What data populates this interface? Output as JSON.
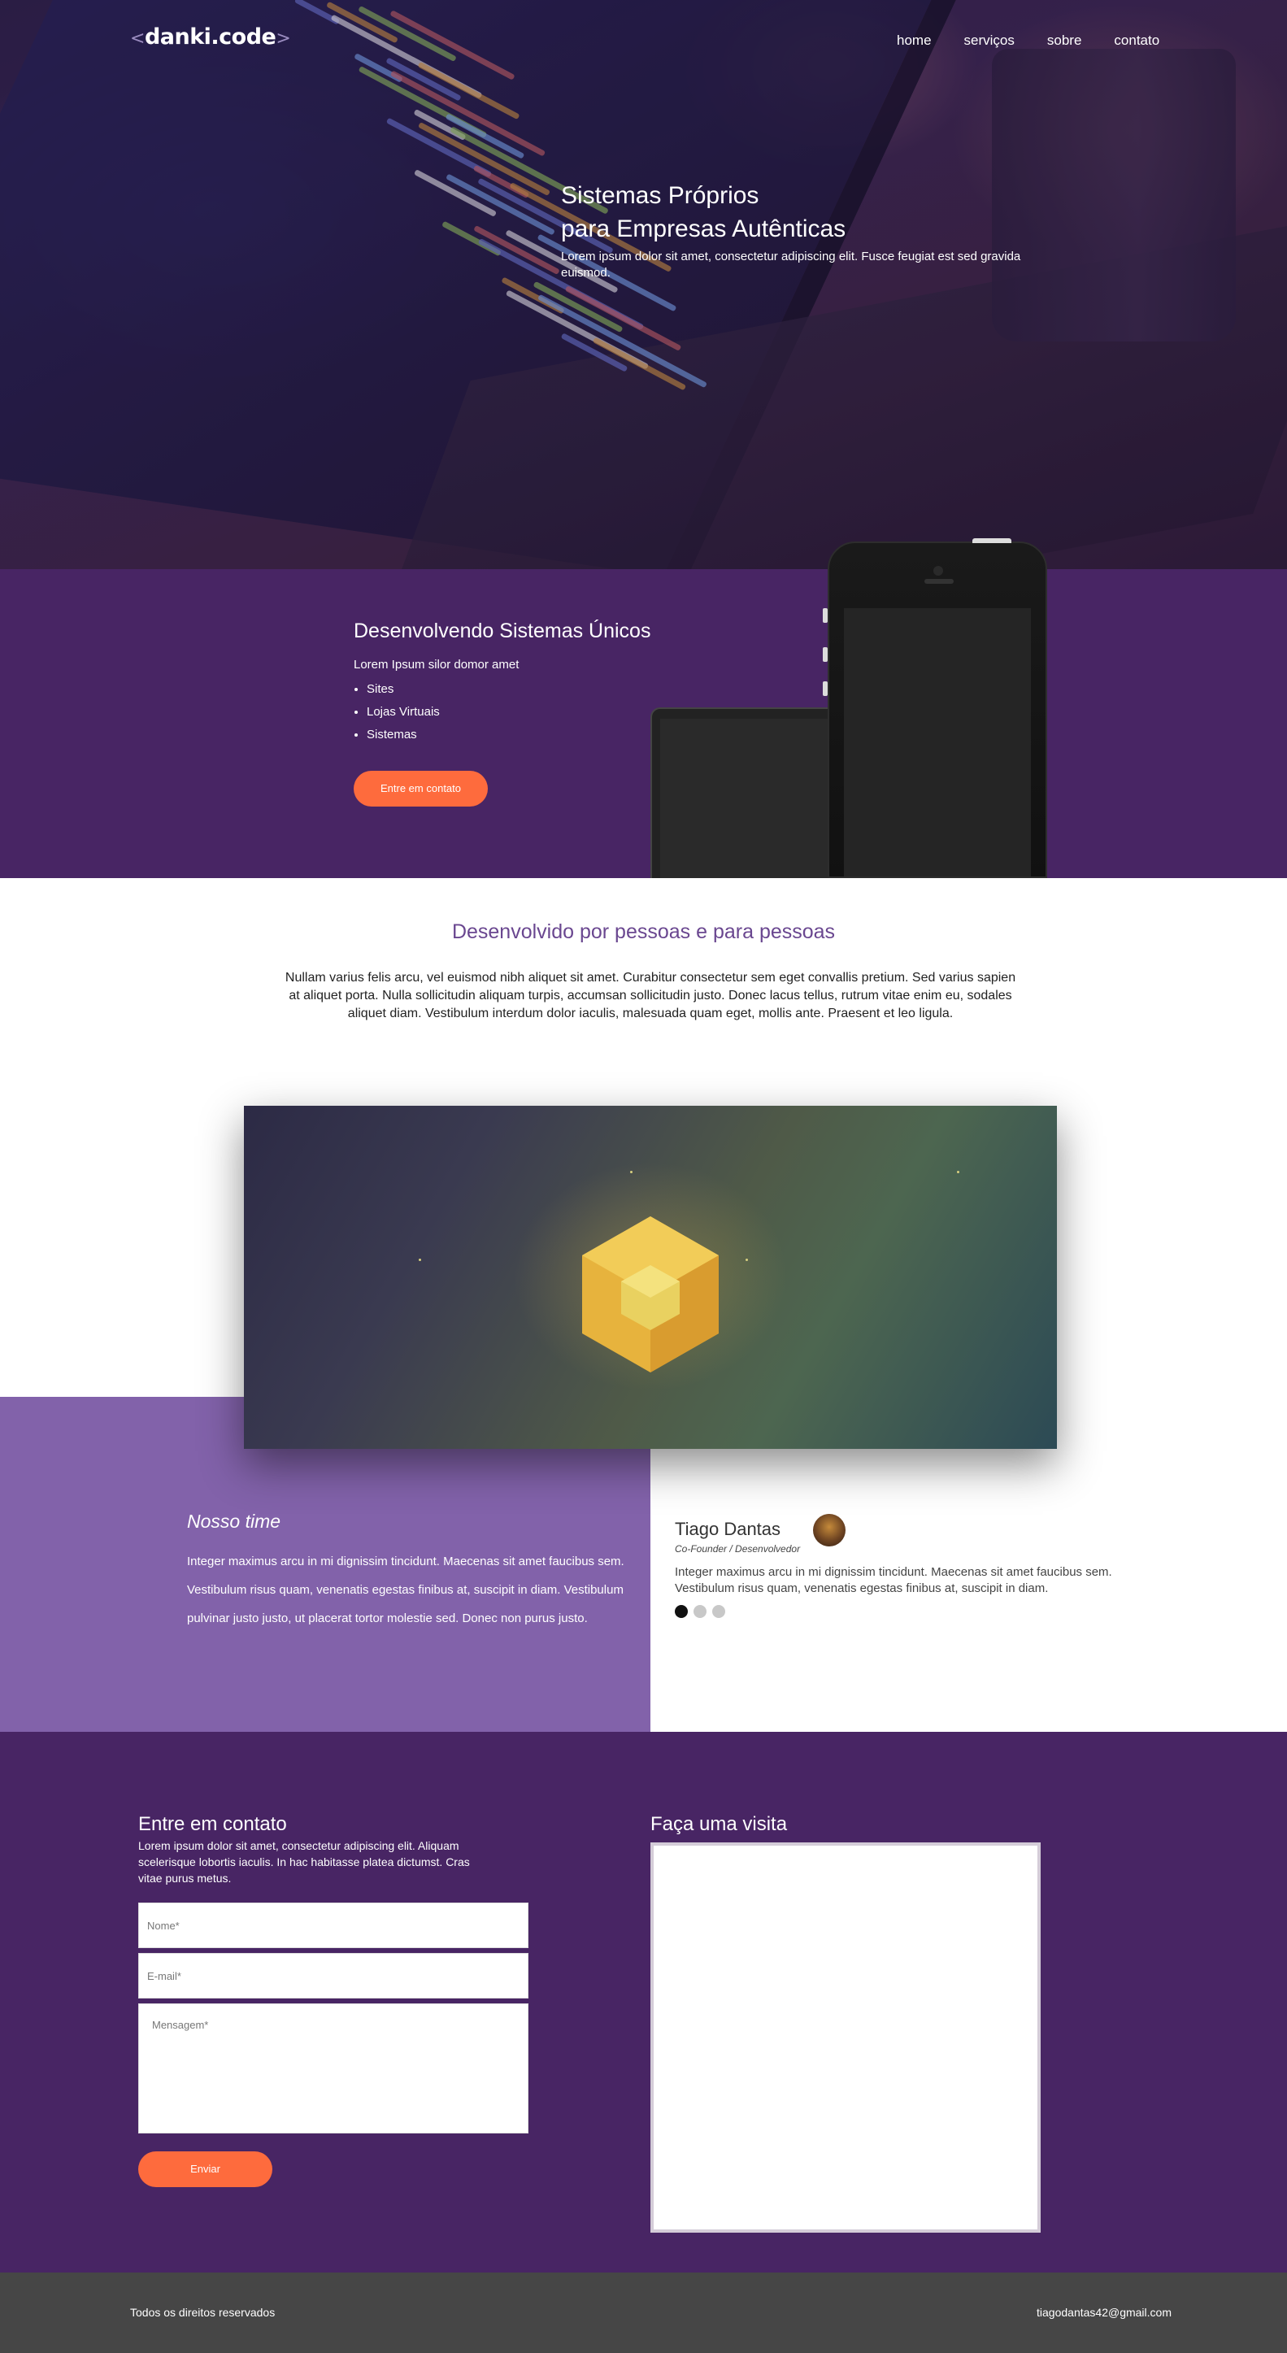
{
  "header": {
    "logo_text": "danki.code",
    "nav": [
      "home",
      "serviços",
      "sobre",
      "contato"
    ]
  },
  "hero": {
    "title_line1": "Sistemas Próprios",
    "title_line2": "para Empresas Autênticas",
    "subtitle": "Lorem ipsum dolor sit amet, consectetur adipiscing elit. Fusce feugiat est sed gravida euismod."
  },
  "services": {
    "title": "Desenvolvendo Sistemas Únicos",
    "lead": "Lorem Ipsum silor domor amet",
    "items": [
      "Sites",
      "Lojas Virtuais",
      "Sistemas"
    ],
    "button": "Entre em contato"
  },
  "about": {
    "title": "Desenvolvido por pessoas e para pessoas",
    "text": "Nullam varius felis arcu, vel euismod nibh aliquet sit amet. Curabitur consectetur sem eget convallis pretium. Sed varius sapien at aliquet porta. Nulla sollicitudin aliquam turpis, accumsan sollicitudin justo. Donec lacus tellus, rutrum vitae enim eu, sodales aliquet diam. Vestibulum interdum dolor iaculis, malesuada quam eget, mollis ante. Praesent et leo ligula."
  },
  "team": {
    "title": "Nosso time",
    "text": "Integer maximus arcu in mi dignissim tincidunt. Maecenas sit amet faucibus sem. Vestibulum risus quam, venenatis egestas finibus at, suscipit in diam. Vestibulum pulvinar justo justo, ut placerat tortor molestie sed. Donec non purus justo.",
    "member": {
      "name": "Tiago Dantas",
      "role": "Co-Founder / Desenvolvedor",
      "text": "Integer maximus arcu in mi dignissim tincidunt. Maecenas sit amet faucibus sem. Vestibulum risus quam, venenatis egestas finibus at, suscipit in diam."
    }
  },
  "contact": {
    "title": "Entre em contato",
    "text": "Lorem ipsum dolor sit amet, consectetur adipiscing elit. Aliquam scelerisque lobortis iaculis. In hac habitasse platea dictumst. Cras vitae purus metus.",
    "name_placeholder": "Nome*",
    "email_placeholder": "E-mail*",
    "message_placeholder": "Mensagem*",
    "send_button": "Enviar",
    "visit_title": "Faça uma visita"
  },
  "footer": {
    "copyright": "Todos os direitos reservados",
    "email": "tiagodantas42@gmail.com"
  },
  "colors": {
    "purple_dark": "#482564",
    "purple_light": "#8262aa",
    "accent_orange": "#fe6b3d",
    "footer_gray": "#464646"
  }
}
